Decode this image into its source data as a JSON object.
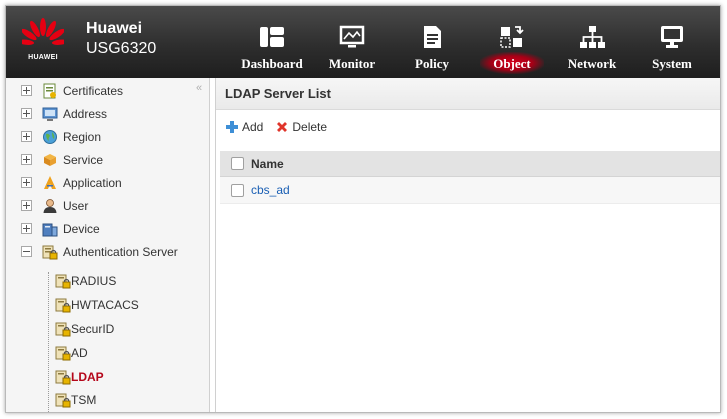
{
  "header": {
    "logo_text": "HUAWEI",
    "brand": "Huawei",
    "model": "USG6320",
    "nav": [
      {
        "label": "Dashboard",
        "icon": "dashboard-icon"
      },
      {
        "label": "Monitor",
        "icon": "monitor-icon"
      },
      {
        "label": "Policy",
        "icon": "policy-icon"
      },
      {
        "label": "Object",
        "icon": "object-icon",
        "active": true
      },
      {
        "label": "Network",
        "icon": "network-icon"
      },
      {
        "label": "System",
        "icon": "system-icon"
      }
    ]
  },
  "sidebar": {
    "collapse_glyph": "«",
    "items": [
      {
        "label": "Certificates",
        "icon": "certificate-icon",
        "expanded": false
      },
      {
        "label": "Address",
        "icon": "address-icon",
        "expanded": false
      },
      {
        "label": "Region",
        "icon": "region-icon",
        "expanded": false
      },
      {
        "label": "Service",
        "icon": "service-icon",
        "expanded": false
      },
      {
        "label": "Application",
        "icon": "application-icon",
        "expanded": false
      },
      {
        "label": "User",
        "icon": "user-icon",
        "expanded": false
      },
      {
        "label": "Device",
        "icon": "device-icon",
        "expanded": false
      },
      {
        "label": "Authentication Server",
        "icon": "auth-server-icon",
        "expanded": true
      }
    ],
    "children": [
      {
        "label": "RADIUS",
        "icon": "server-lock-icon"
      },
      {
        "label": "HWTACACS",
        "icon": "server-lock-icon"
      },
      {
        "label": "SecurID",
        "icon": "server-lock-icon"
      },
      {
        "label": "AD",
        "icon": "server-lock-icon"
      },
      {
        "label": "LDAP",
        "icon": "server-lock-icon",
        "active": true
      },
      {
        "label": "TSM",
        "icon": "server-lock-icon"
      }
    ]
  },
  "main": {
    "title": "LDAP Server List",
    "toolbar": {
      "add_label": "Add",
      "delete_label": "Delete"
    },
    "table": {
      "columns": [
        "Name"
      ],
      "rows": [
        {
          "name": "cbs_ad"
        }
      ]
    }
  },
  "colors": {
    "accent_red": "#b5061a",
    "link_blue": "#1a5fb4",
    "header_dark": "#2e2e2e"
  }
}
